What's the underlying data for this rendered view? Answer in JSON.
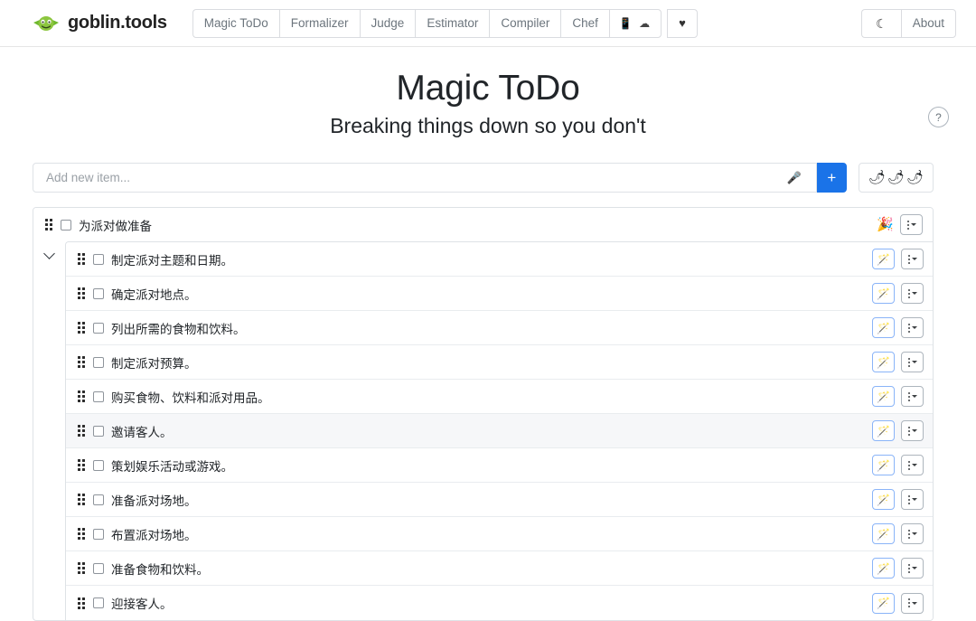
{
  "navbar": {
    "brand": "goblin.tools",
    "logo_icon": "goblin-face-icon",
    "tabs": [
      {
        "label": "Magic ToDo",
        "name": "magic-todo"
      },
      {
        "label": "Formalizer",
        "name": "formalizer"
      },
      {
        "label": "Judge",
        "name": "judge"
      },
      {
        "label": "Estimator",
        "name": "estimator"
      },
      {
        "label": "Compiler",
        "name": "compiler"
      },
      {
        "label": "Chef",
        "name": "chef"
      }
    ],
    "platforms_label": "📱 ☁ ",
    "donate_label": "♥",
    "dark_mode_label": "☾",
    "about_label": "About"
  },
  "header": {
    "title": "Magic ToDo",
    "subtitle": "Breaking things down so you don't",
    "help_label": "?"
  },
  "add_item": {
    "placeholder": "Add new item...",
    "value": "",
    "mic_label": "🎤",
    "add_label": "+",
    "spiciness": [
      "🌶",
      "🌶",
      "🌶"
    ]
  },
  "colors": {
    "accent": "#1a73e8",
    "border": "#dee2e6",
    "row_highlight": "#f6f7f9",
    "brand_green": "#7ac143"
  },
  "todo": {
    "parent": {
      "label": "为派对做准备",
      "emoji": "🎉",
      "checked": false,
      "menu_label": "⋮"
    },
    "children": [
      {
        "label": "制定派对主题和日期。",
        "checked": false,
        "highlighted": false
      },
      {
        "label": "确定派对地点。",
        "checked": false,
        "highlighted": false
      },
      {
        "label": "列出所需的食物和饮料。",
        "checked": false,
        "highlighted": false
      },
      {
        "label": "制定派对预算。",
        "checked": false,
        "highlighted": false
      },
      {
        "label": "购买食物、饮料和派对用品。",
        "checked": false,
        "highlighted": false
      },
      {
        "label": "邀请客人。",
        "checked": false,
        "highlighted": true
      },
      {
        "label": "策划娱乐活动或游戏。",
        "checked": false,
        "highlighted": false
      },
      {
        "label": "准备派对场地。",
        "checked": false,
        "highlighted": false
      },
      {
        "label": "布置派对场地。",
        "checked": false,
        "highlighted": false
      },
      {
        "label": "准备食物和饮料。",
        "checked": false,
        "highlighted": false
      },
      {
        "label": "迎接客人。",
        "checked": false,
        "highlighted": false
      }
    ],
    "child_wand_label": "🪄",
    "child_menu_label": "⋮"
  }
}
